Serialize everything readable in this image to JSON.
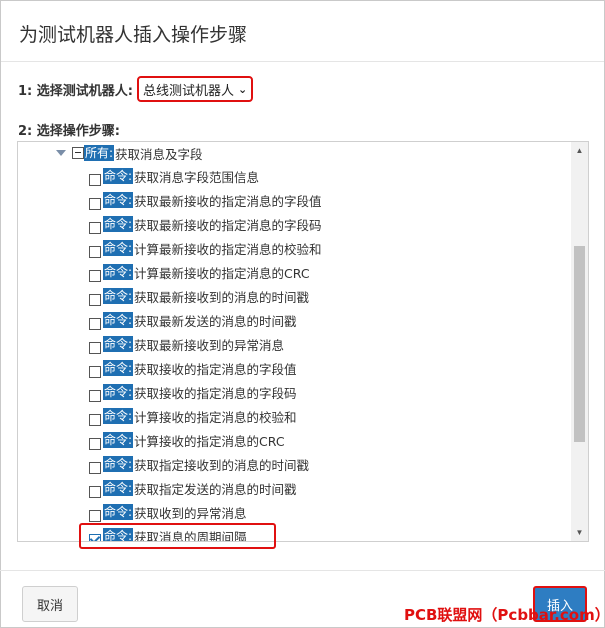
{
  "dialog": {
    "title": "为测试机器人插入操作步骤"
  },
  "step1": {
    "label": "1: 选择测试机器人:",
    "selected": "总线测试机器人"
  },
  "step2": {
    "label": "2: 选择操作步骤:"
  },
  "tree": {
    "parent": {
      "tag": "所有:",
      "text": "获取消息及字段"
    },
    "items": [
      {
        "tag": "命令:",
        "text": "获取消息字段范围信息",
        "checked": false
      },
      {
        "tag": "命令:",
        "text": "获取最新接收的指定消息的字段值",
        "checked": false
      },
      {
        "tag": "命令:",
        "text": "获取最新接收的指定消息的字段码",
        "checked": false
      },
      {
        "tag": "命令:",
        "text": "计算最新接收的指定消息的校验和",
        "checked": false
      },
      {
        "tag": "命令:",
        "text": "计算最新接收的指定消息的CRC",
        "checked": false
      },
      {
        "tag": "命令:",
        "text": "获取最新接收到的消息的时间戳",
        "checked": false
      },
      {
        "tag": "命令:",
        "text": "获取最新发送的消息的时间戳",
        "checked": false
      },
      {
        "tag": "命令:",
        "text": "获取最新接收到的异常消息",
        "checked": false
      },
      {
        "tag": "命令:",
        "text": "获取接收的指定消息的字段值",
        "checked": false
      },
      {
        "tag": "命令:",
        "text": "获取接收的指定消息的字段码",
        "checked": false
      },
      {
        "tag": "命令:",
        "text": "计算接收的指定消息的校验和",
        "checked": false
      },
      {
        "tag": "命令:",
        "text": "计算接收的指定消息的CRC",
        "checked": false
      },
      {
        "tag": "命令:",
        "text": "获取指定接收到的消息的时间戳",
        "checked": false
      },
      {
        "tag": "命令:",
        "text": "获取指定发送的消息的时间戳",
        "checked": false
      },
      {
        "tag": "命令:",
        "text": "获取收到的异常消息",
        "checked": false
      },
      {
        "tag": "命令:",
        "text": "获取消息的周期间隔",
        "checked": true
      }
    ]
  },
  "footer": {
    "cancel_label": "取消",
    "insert_label": "插入"
  },
  "watermark": "PCB联盟网（Pcbbar.com）"
}
